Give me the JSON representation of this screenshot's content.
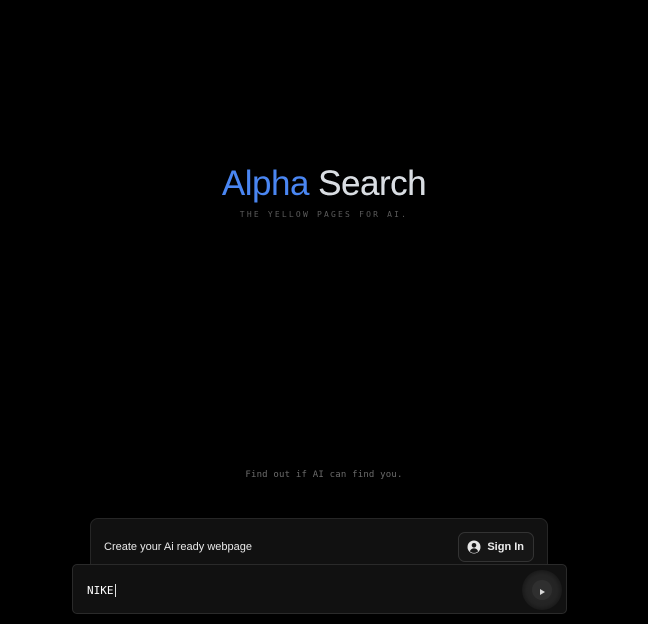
{
  "hero": {
    "brand_first": "Alpha",
    "brand_second": "Search",
    "tagline": "THE YELLOW PAGES FOR AI."
  },
  "prompt": {
    "find_out": "Find out if AI can find you."
  },
  "promo": {
    "text": "Create your Ai ready webpage",
    "signin_label": "Sign In",
    "signin_icon": "user-circle-icon"
  },
  "search": {
    "value": "NIKE",
    "send_icon": "play-icon"
  },
  "colors": {
    "background": "#000000",
    "brand_blue": "#4a86f2",
    "card": "#111111"
  }
}
